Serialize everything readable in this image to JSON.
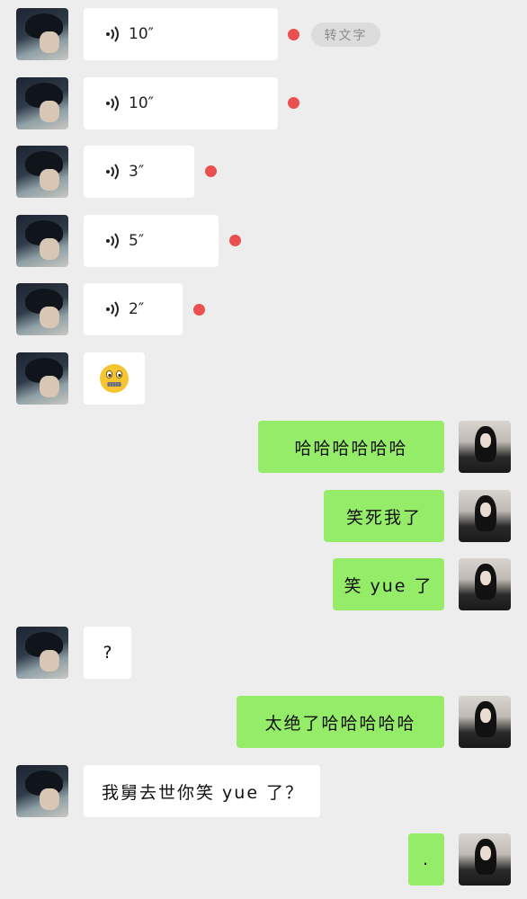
{
  "colors": {
    "background": "#ededed",
    "my_bubble": "#95ec69",
    "their_bubble": "#ffffff",
    "unread_dot": "#ea5050"
  },
  "voice_messages": [
    {
      "duration": "10″"
    },
    {
      "duration": "10″"
    },
    {
      "duration": "3″"
    },
    {
      "duration": "5″"
    },
    {
      "duration": "2″"
    }
  ],
  "to_text_label": "转文字",
  "emoji_message": {
    "icon": "zipper-mouth-face-emoji"
  },
  "messages": {
    "m1": "哈哈哈哈哈哈",
    "m2": "笑死我了",
    "m3": "笑 yue 了",
    "m4": "?",
    "m5": "太绝了哈哈哈哈哈",
    "m6": "我舅去世你笑 yue 了？",
    "m7": "."
  }
}
